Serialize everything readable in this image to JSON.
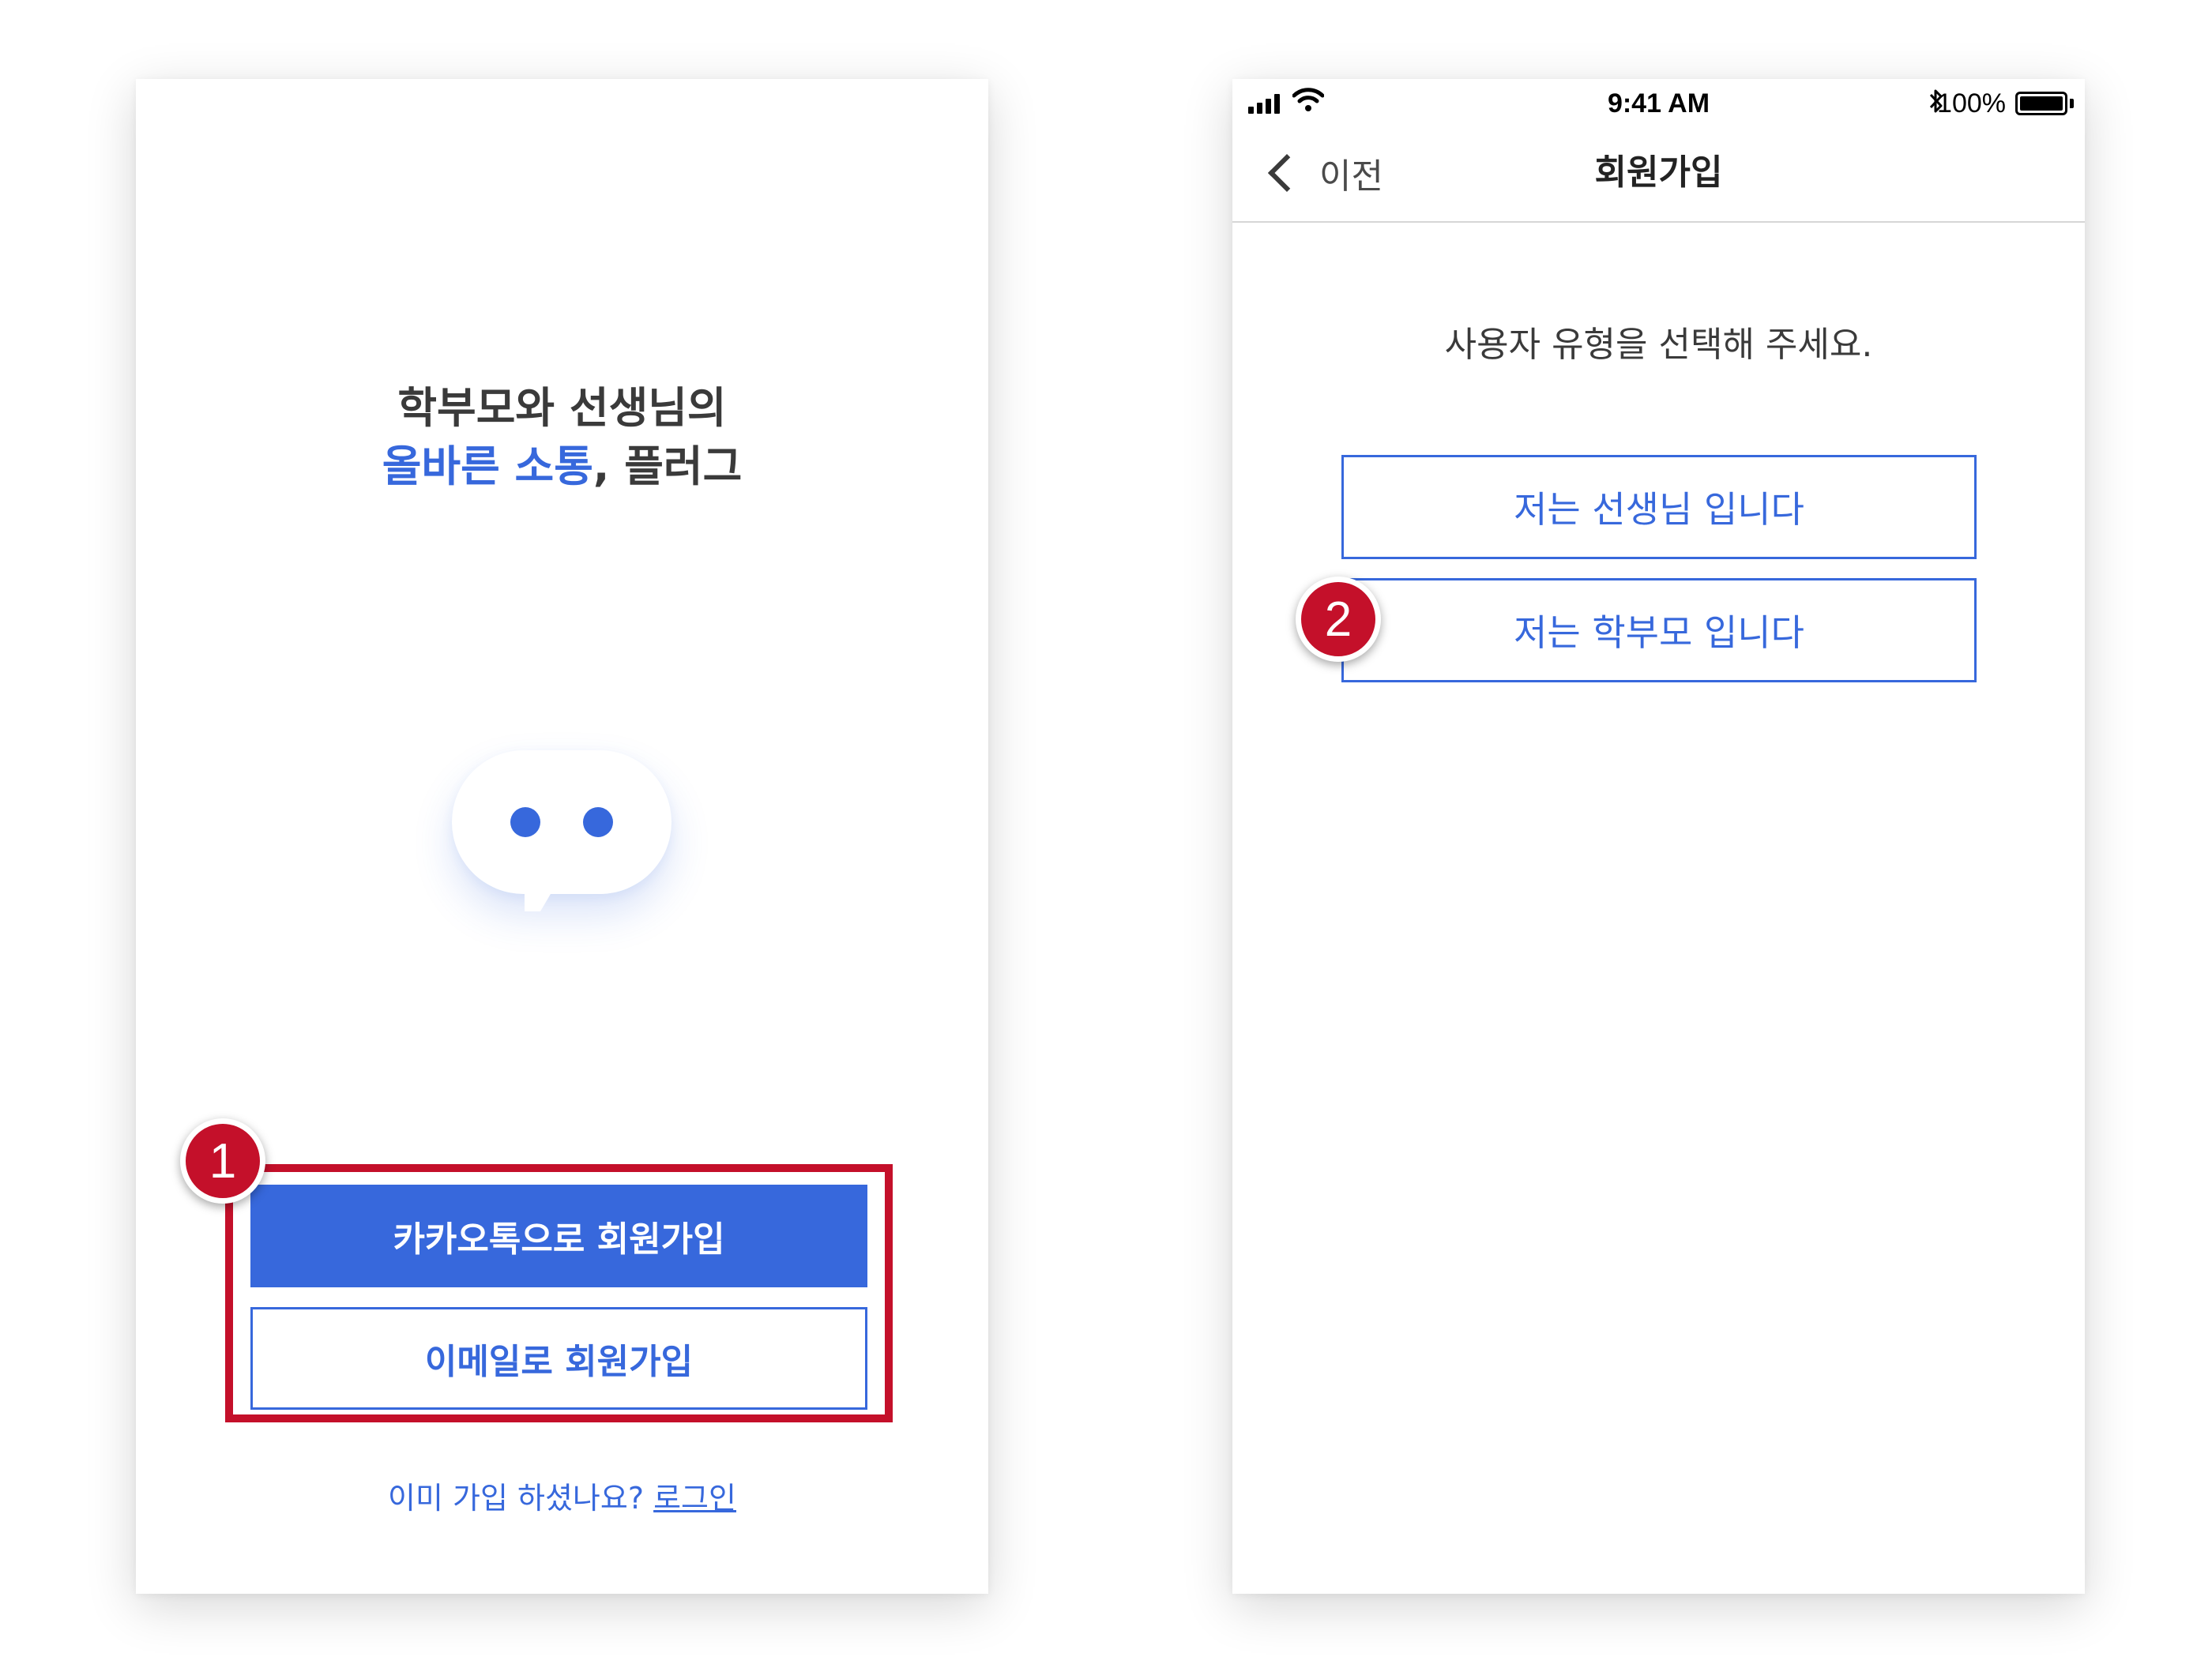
{
  "left_screen": {
    "tagline_line1": "학부모와 선생님의",
    "tagline_highlight": "올바른 소통",
    "tagline_rest": ", 플러그",
    "kakao_signup_label": "카카오톡으로 회원가입",
    "email_signup_label": "이메일로 회원가입",
    "login_prompt": "이미 가입 하셨나요? ",
    "login_link": "로그인",
    "chat_bubble_icon": "chat-bubble-icon",
    "step_marker": "1"
  },
  "right_screen": {
    "status_bar": {
      "time": "9:41 AM",
      "battery_percent": "100%",
      "battery_level": 1.0,
      "icons": [
        "signal-icon",
        "wifi-icon",
        "bluetooth-icon",
        "battery-icon"
      ]
    },
    "nav": {
      "back_label": "이전",
      "title": "회원가입"
    },
    "prompt": "사용자 유형을 선택해 주세요.",
    "teacher_option": "저는 선생님 입니다",
    "parent_option": "저는 학부모 입니다",
    "step_marker": "2"
  },
  "colors": {
    "accent_blue": "#3768dc",
    "marker_red": "#c4102a",
    "text_dark": "#3a3a3a"
  }
}
